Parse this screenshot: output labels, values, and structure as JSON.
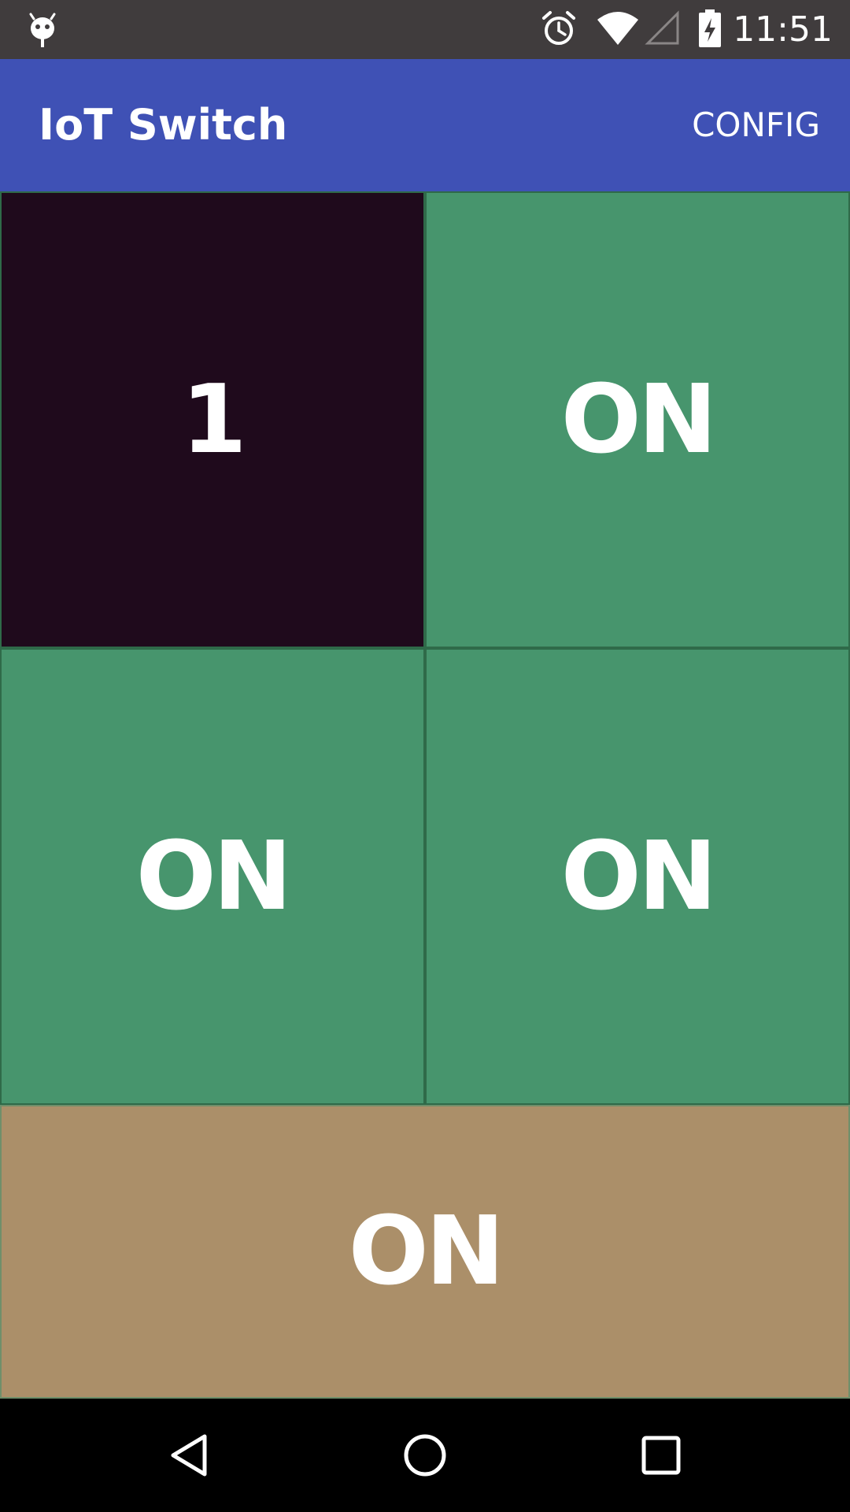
{
  "status_bar": {
    "time": "11:51",
    "icons": [
      "android-debug-icon",
      "alarm-icon",
      "wifi-icon",
      "cell-signal-icon",
      "battery-charging-icon"
    ]
  },
  "app_bar": {
    "title": "IoT Switch",
    "config_label": "CONFIG"
  },
  "tiles": [
    {
      "label": "1",
      "color": "#1F0A1C"
    },
    {
      "label": "ON",
      "color": "#47956D"
    },
    {
      "label": "ON",
      "color": "#47956D"
    },
    {
      "label": "ON",
      "color": "#47956D"
    },
    {
      "label": "ON",
      "color": "#AB8F69"
    }
  ],
  "colors": {
    "status_bar": "#403C3D",
    "app_bar": "#3F51B5",
    "nav_bar": "#000000"
  },
  "nav_bar": {
    "icons": [
      "back-icon",
      "home-icon",
      "recents-icon"
    ]
  }
}
